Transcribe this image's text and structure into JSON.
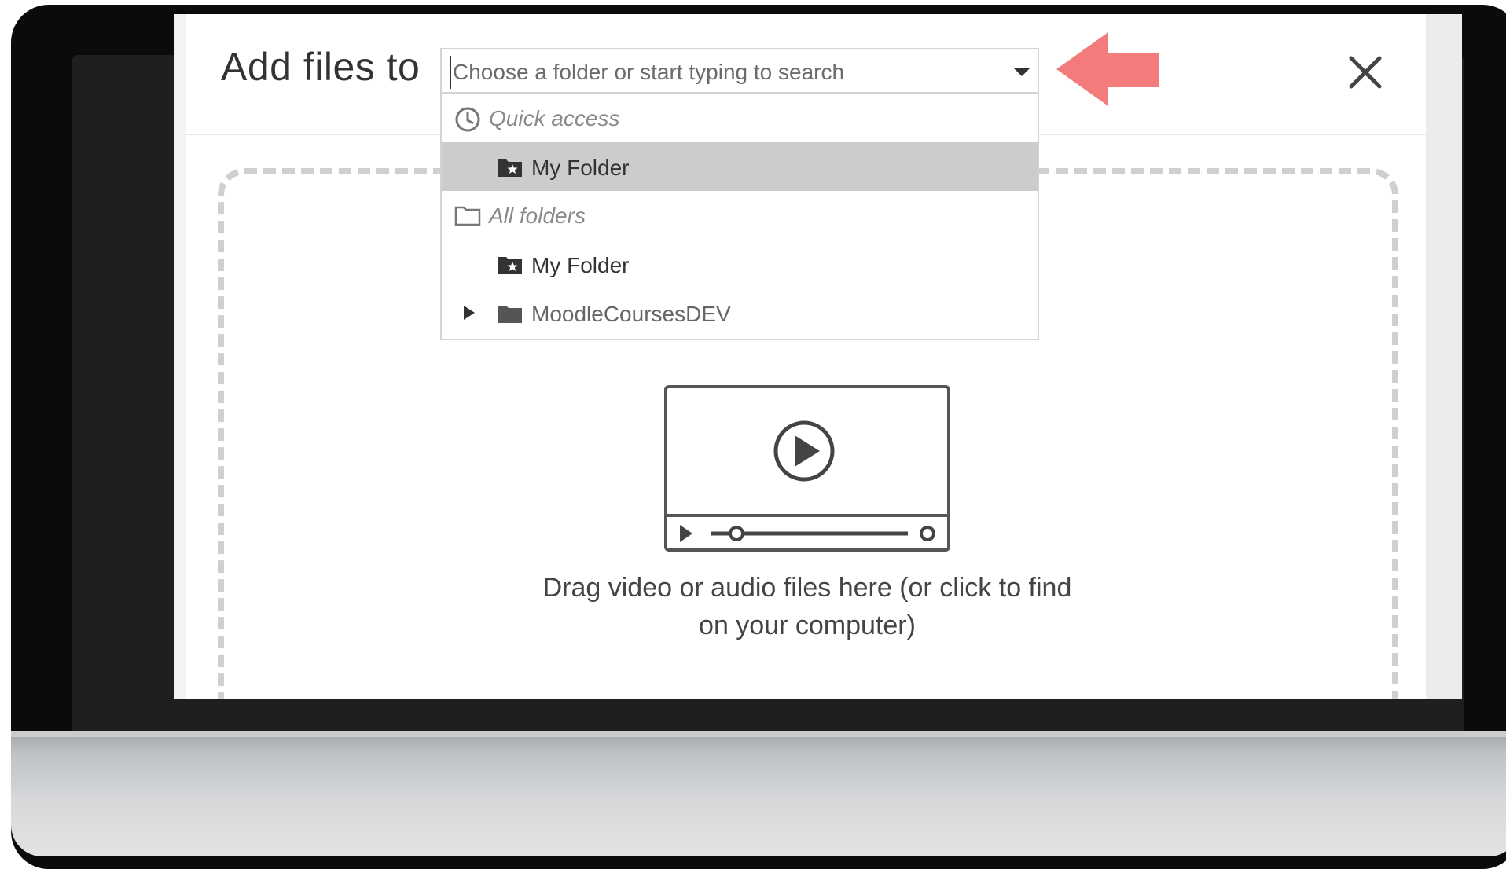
{
  "dialog": {
    "title": "Add files to",
    "close_icon": "close-icon"
  },
  "folder_picker": {
    "placeholder": "Choose a folder or start typing to search",
    "caret_icon": "caret-down-icon",
    "sections": [
      {
        "header": "Quick access",
        "icon": "clock-icon",
        "items": [
          {
            "label": "My Folder",
            "icon": "starred-folder-icon",
            "selected": true
          }
        ]
      },
      {
        "header": "All folders",
        "icon": "folder-outline-icon",
        "items": [
          {
            "label": "My Folder",
            "icon": "starred-folder-icon",
            "selected": false
          },
          {
            "label": "MoodleCoursesDEV",
            "icon": "folder-icon",
            "expandable": true,
            "selected": false
          }
        ]
      }
    ]
  },
  "dropzone": {
    "icon": "video-player-icon",
    "text_line1": "Drag video or audio files here (or click to find",
    "text_line2": "on your computer)"
  },
  "annotation": {
    "icon": "left-arrow-icon",
    "color": "#f47b7b"
  },
  "colors": {
    "monitor_bezel": "#0b0b0b",
    "selected_row": "#cccccc",
    "dashed_border": "#d0d0d0"
  }
}
